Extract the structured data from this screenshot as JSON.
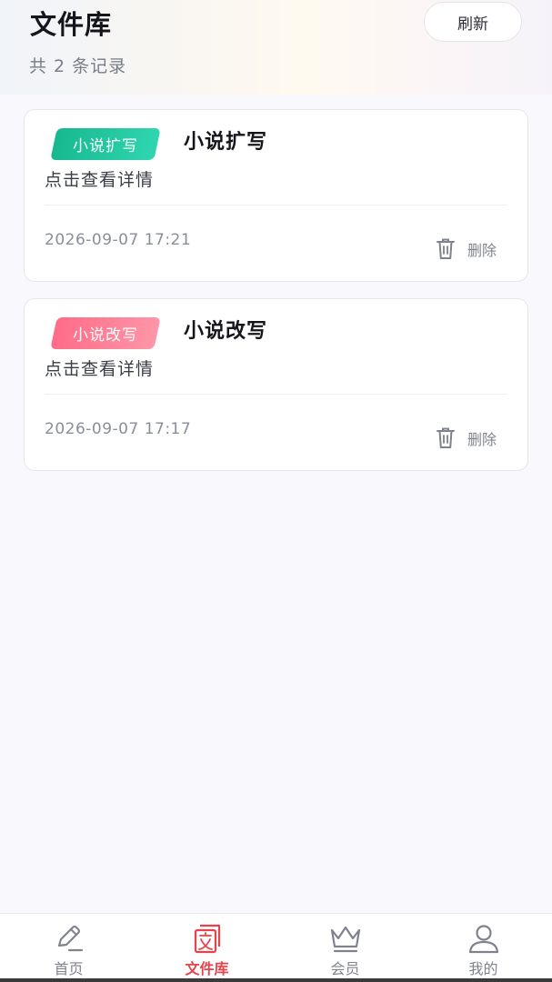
{
  "header": {
    "title": "文件库",
    "record_count": "共 2 条记录",
    "refresh_label": "刷新"
  },
  "cards": [
    {
      "tag": "小说扩写",
      "title": "小说扩写",
      "subtitle": "点击查看详情",
      "time": "2026-09-07 17:21",
      "delete_label": "删除",
      "tag_color": "#1fc79e"
    },
    {
      "tag": "小说改写",
      "title": "小说改写",
      "subtitle": "点击查看详情",
      "time": "2026-09-07 17:17",
      "delete_label": "删除",
      "tag_color": "#ff7c93"
    }
  ],
  "tabbar": {
    "items": [
      {
        "label": "首页",
        "icon": "pencil-icon",
        "active": false
      },
      {
        "label": "文件库",
        "icon": "document-library-icon",
        "active": true
      },
      {
        "label": "会员",
        "icon": "crown-icon",
        "active": false
      },
      {
        "label": "我的",
        "icon": "user-icon",
        "active": false
      }
    ]
  },
  "colors": {
    "accent": "#e8434a",
    "inactive": "#80838d",
    "background": "#f9f8fc"
  }
}
